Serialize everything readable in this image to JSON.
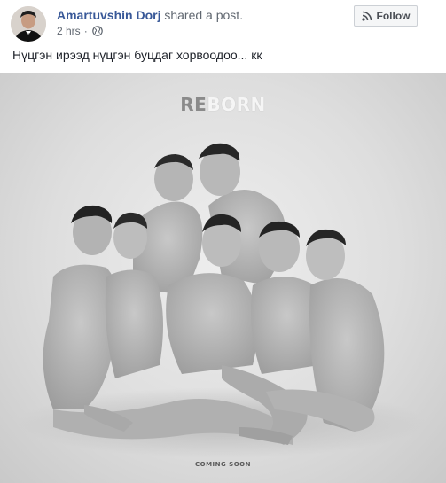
{
  "post": {
    "author": "Amartuvshin Dorj",
    "action": " shared a post.",
    "time": "2 hrs",
    "separator": "·",
    "follow_label": "Follow",
    "text": "Нүцгэн ирээд нүцгэн буцдаг хорвоодоо... кк"
  },
  "photo": {
    "title_part1": "RE",
    "title_part2": "BORN",
    "subtitle": "COMING SOON"
  },
  "icons": {
    "privacy": "globe-icon",
    "follow": "rss-icon"
  }
}
